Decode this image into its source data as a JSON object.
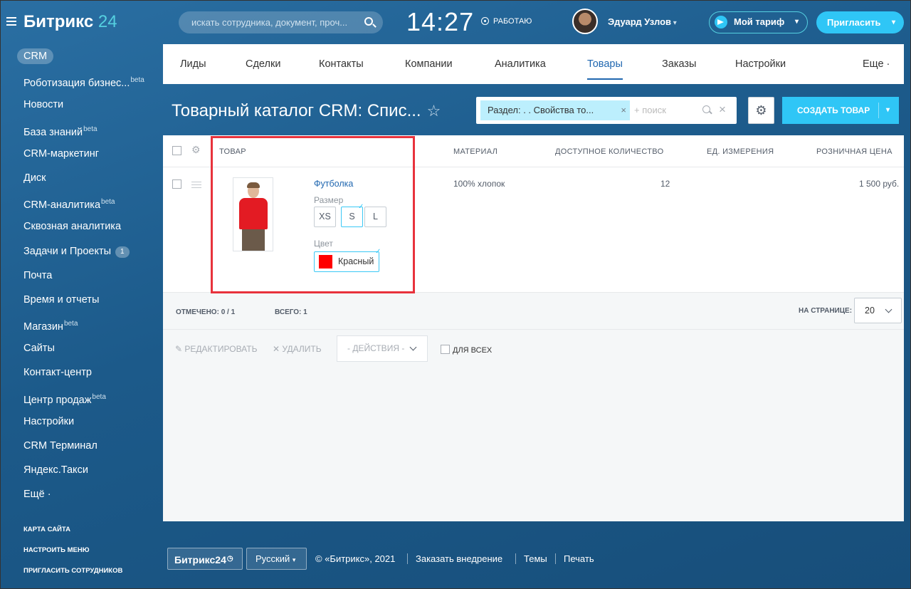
{
  "header": {
    "logo_main": "Битрикс",
    "logo_num": "24",
    "search_placeholder": "искать сотрудника, документ, проч...",
    "time": "14:27",
    "status": "РАБОТАЮ",
    "user_name": "Эдуард Узлов",
    "tariff_label": "Мой тариф",
    "invite_label": "Пригласить"
  },
  "sidebar": {
    "items": [
      {
        "label": "CRM"
      },
      {
        "label": "Роботизация бизнес...",
        "sup": "beta"
      },
      {
        "label": "Новости"
      },
      {
        "label": "База знаний",
        "sup": "beta"
      },
      {
        "label": "CRM-маркетинг"
      },
      {
        "label": "Диск"
      },
      {
        "label": "CRM-аналитика",
        "sup": "beta"
      },
      {
        "label": "Сквозная аналитика"
      },
      {
        "label": "Задачи и Проекты",
        "badge": "1"
      },
      {
        "label": "Почта"
      },
      {
        "label": "Время и отчеты"
      },
      {
        "label": "Магазин",
        "sup": "beta"
      },
      {
        "label": "Сайты"
      },
      {
        "label": "Контакт-центр"
      },
      {
        "label": "Центр продаж",
        "sup": "beta"
      },
      {
        "label": "Настройки"
      },
      {
        "label": "CRM Терминал"
      },
      {
        "label": "Яндекс.Такси"
      },
      {
        "label": "Ещё ·"
      }
    ],
    "bottom": [
      "КАРТА САЙТА",
      "НАСТРОИТЬ МЕНЮ",
      "ПРИГЛАСИТЬ СОТРУДНИКОВ"
    ]
  },
  "tabs": [
    {
      "label": "Лиды"
    },
    {
      "label": "Сделки"
    },
    {
      "label": "Контакты"
    },
    {
      "label": "Компании"
    },
    {
      "label": "Аналитика"
    },
    {
      "label": "Товары",
      "active": true
    },
    {
      "label": "Заказы"
    },
    {
      "label": "Настройки"
    },
    {
      "label": "Еще ·"
    }
  ],
  "page": {
    "title": "Товарный каталог CRM: Спис...",
    "filter_chip": "Раздел: . . Свойства то...",
    "filter_placeholder": "+ поиск",
    "create_label": "СОЗДАТЬ ТОВАР"
  },
  "table": {
    "columns": [
      "ТОВАР",
      "МАТЕРИАЛ",
      "ДОСТУПНОЕ КОЛИЧЕСТВО",
      "ЕД. ИЗМЕРЕНИЯ",
      "РОЗНИЧНАЯ ЦЕНА"
    ],
    "row": {
      "name": "Футболка",
      "size_label": "Размер",
      "sizes": [
        "XS",
        "S",
        "L"
      ],
      "selected_size": "S",
      "color_label": "Цвет",
      "color_value": "Красный",
      "color_hex": "#ff0000",
      "material": "100% хлопок",
      "quantity": "12",
      "unit": "",
      "price": "1 500 руб."
    },
    "checked": "ОТМЕЧЕНО: 0 / 1",
    "total": "ВСЕГО: 1",
    "per_page_label": "НА СТРАНИЦЕ:",
    "per_page": "20"
  },
  "actions": {
    "edit": "РЕДАКТИРОВАТЬ",
    "delete": "УДАЛИТЬ",
    "select": "- ДЕЙСТВИЯ -",
    "for_all": "ДЛЯ ВСЕХ"
  },
  "footer": {
    "brand": "Битрикс24",
    "lang": "Русский",
    "copyright": "© «Битрикс», 2021",
    "links": [
      "Заказать внедрение",
      "Темы",
      "Печать"
    ]
  },
  "colors": {
    "accent": "#2fc6f6",
    "background": "#1c5a8a",
    "highlight_box": "#e8323c"
  }
}
